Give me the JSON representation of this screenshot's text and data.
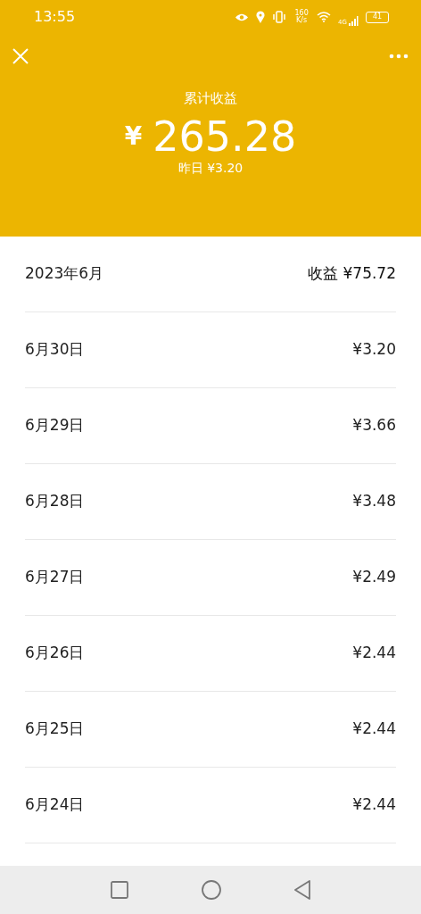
{
  "status_bar": {
    "time": "13:55",
    "speed": "160 K/s",
    "network": "4G",
    "battery": "41"
  },
  "header": {
    "title": "累计收益",
    "currency": "¥",
    "total": "265.28",
    "yesterday": "昨日 ¥3.20"
  },
  "month": {
    "label": "2023年6月",
    "earnings": "收益 ¥75.72"
  },
  "days": [
    {
      "date": "6月30日",
      "amount": "¥3.20"
    },
    {
      "date": "6月29日",
      "amount": "¥3.66"
    },
    {
      "date": "6月28日",
      "amount": "¥3.48"
    },
    {
      "date": "6月27日",
      "amount": "¥2.49"
    },
    {
      "date": "6月26日",
      "amount": "¥2.44"
    },
    {
      "date": "6月25日",
      "amount": "¥2.44"
    },
    {
      "date": "6月24日",
      "amount": "¥2.44"
    }
  ]
}
